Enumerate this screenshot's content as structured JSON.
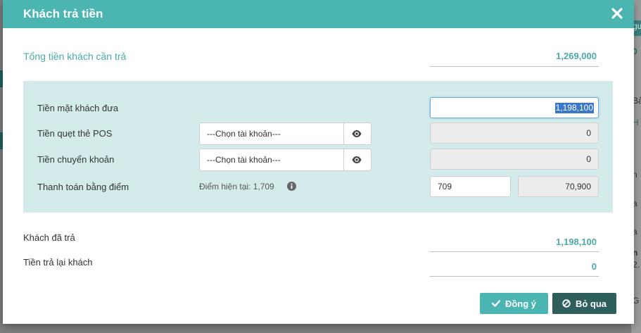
{
  "modal": {
    "title": "Khách trả tiền"
  },
  "summary": {
    "total_label": "Tổng tiền khách cần trả",
    "total_value": "1,269,000"
  },
  "payment": {
    "cash_label": "Tiền mặt khách đưa",
    "cash_value": "1,198,100",
    "pos_label": "Tiền quẹt thẻ POS",
    "pos_account_placeholder": "---Chọn tài khoản---",
    "pos_value": "0",
    "transfer_label": "Tiền chuyển khoản",
    "transfer_account_placeholder": "---Chọn tài khoản---",
    "transfer_value": "0",
    "points_label": "Thanh toán bằng điểm",
    "points_current": "Điểm hiện tại: 1,709",
    "points_used": "709",
    "points_amount": "70,900"
  },
  "result": {
    "paid_label": "Khách đã trả",
    "paid_value": "1,198,100",
    "change_label": "Tiền trả lại khách",
    "change_value": "0"
  },
  "actions": {
    "ok_label": "Đồng ý",
    "skip_label": "Bỏ qua"
  },
  "icons": {
    "close": "close-icon",
    "eye": "eye-icon",
    "info": "info-icon",
    "check": "check-icon",
    "ban": "ban-icon"
  },
  "colors": {
    "header": "#4bb5b1",
    "accent_text": "#4aaba8",
    "panel": "#d3eceb",
    "skip_button": "#2f5f5d"
  },
  "background": {
    "fragments": [
      "gu",
      "0",
      "Bả",
      "H",
      "n",
      "a",
      "a",
      "n",
      "2.",
      "G"
    ]
  }
}
